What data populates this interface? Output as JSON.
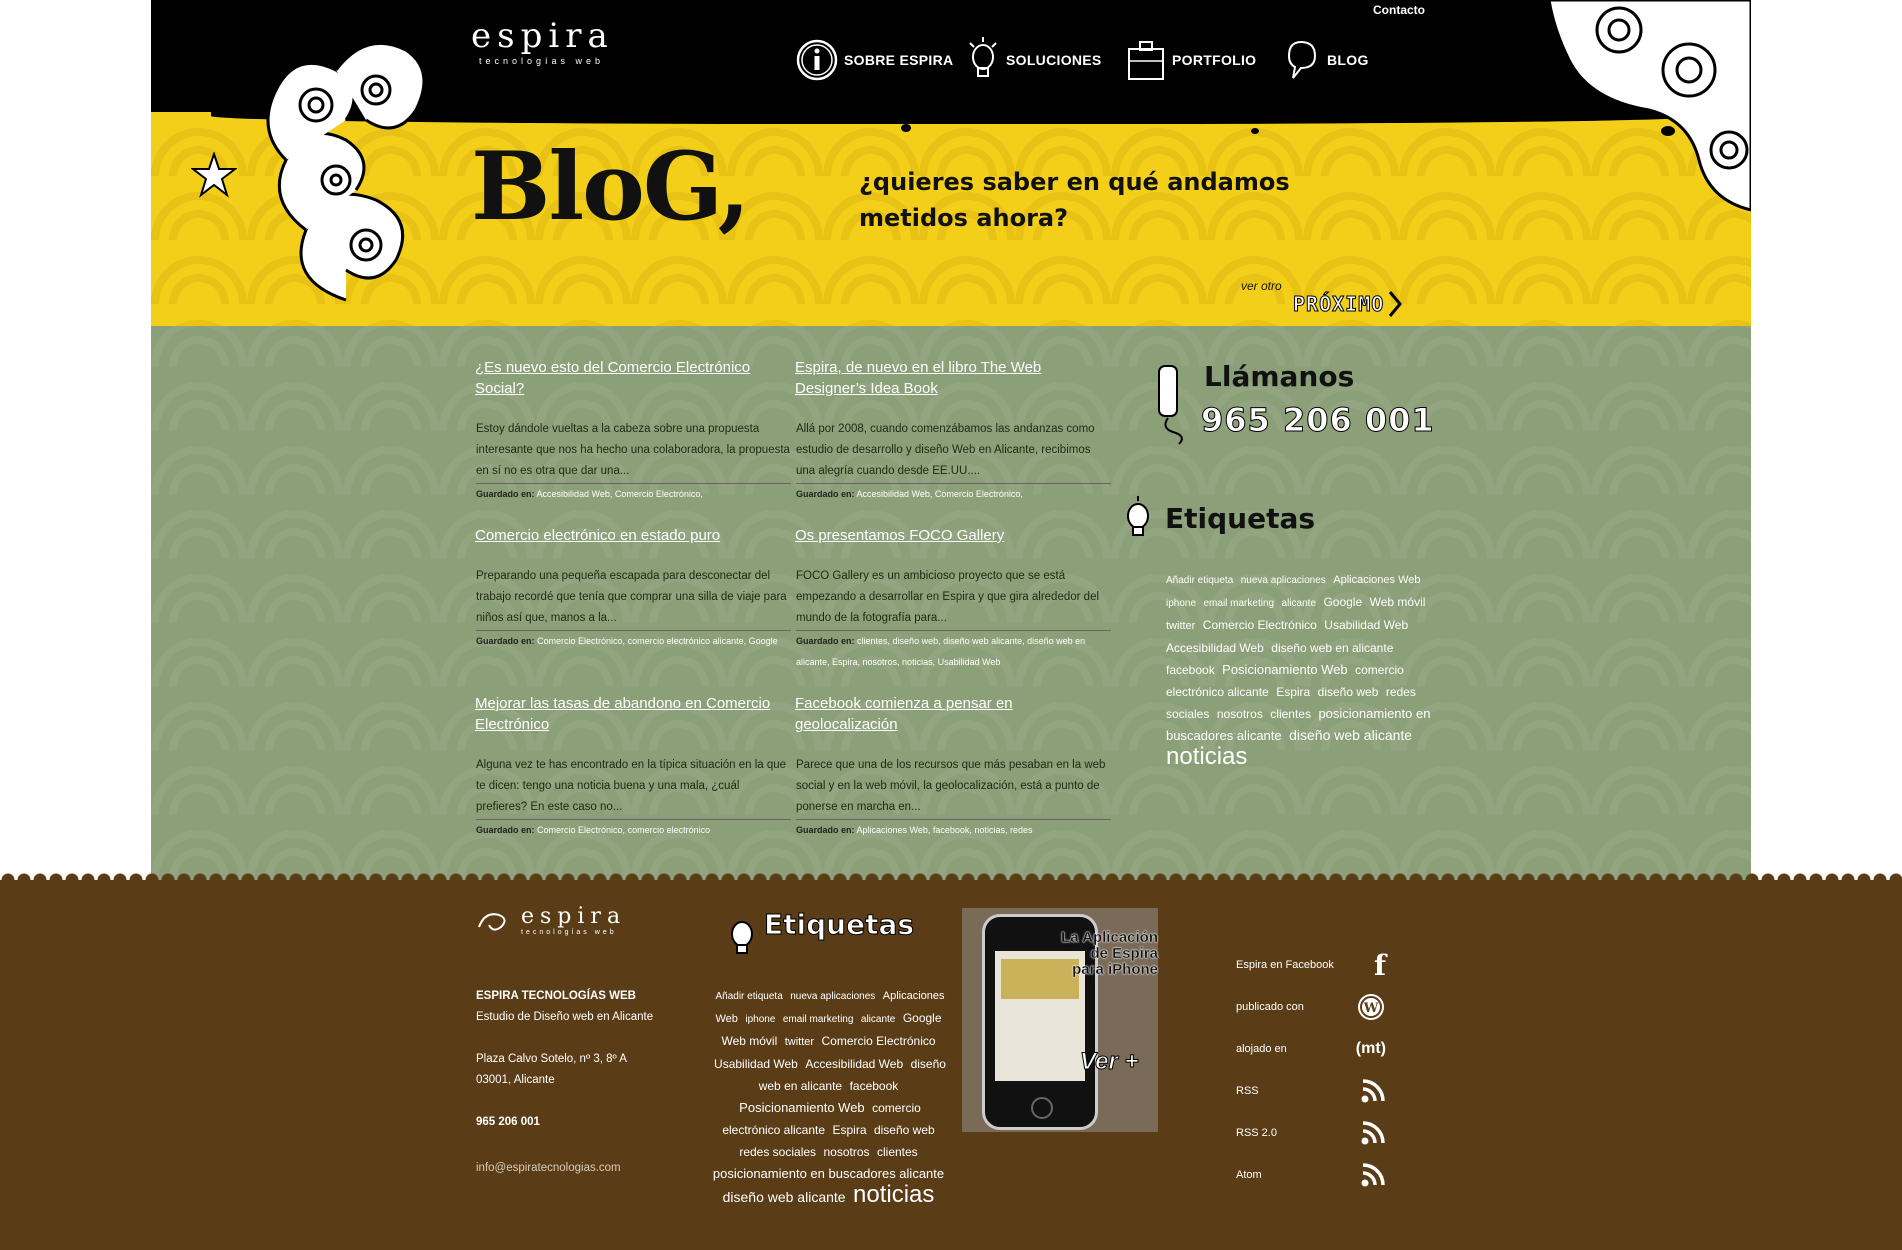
{
  "header": {
    "logo_main": "espira",
    "logo_sub": "tecnologías web",
    "contact_link": "Contacto",
    "nav": [
      {
        "label": "SOBRE ESPIRA",
        "icon": "info-icon"
      },
      {
        "label": "SOLUCIONES",
        "icon": "lightbulb-icon"
      },
      {
        "label": "PORTFOLIO",
        "icon": "briefcase-icon"
      },
      {
        "label": "BLOG",
        "icon": "speech-icon"
      }
    ]
  },
  "hero": {
    "title": "BloG,",
    "tagline_1": "¿quieres saber en qué andamos",
    "tagline_2": "metidos ahora?",
    "next_small": "ver otro",
    "next_label": "PRÓXIMO"
  },
  "posts": [
    {
      "title": "¿Es nuevo esto del Comercio Electrónico Social?",
      "excerpt": "Estoy dándole vueltas a la cabeza sobre una propuesta interesante que nos ha hecho una colaboradora, la propuesta en sí no es otra que dar una...",
      "tags_label": "Guardado en:",
      "tags": "Accesibilidad Web, Comercio Electrónico,"
    },
    {
      "title": "Espira, de nuevo en el libro The Web Designer’s Idea Book",
      "excerpt": "Allá por 2008, cuando comenzábamos las andanzas como estudio de desarrollo y diseño Web en Alicante, recibimos una alegría cuando desde EE.UU....",
      "tags_label": "Guardado en:",
      "tags": "Accesibilidad Web, Comercio Electrónico,"
    },
    {
      "title": "Comercio electrónico en estado puro",
      "excerpt": "Preparando una pequeña escapada para desconectar del trabajo recordé que tenía que comprar una silla de viaje para niños así que, manos a la...",
      "tags_label": "Guardado en:",
      "tags": "Comercio Electrónico, comercio electrónico alicante, Google"
    },
    {
      "title": "Os presentamos FOCO Gallery",
      "excerpt": "FOCO Gallery es un ambicioso proyecto que se está empezando a desarrollar en Espira y que gira alrededor del mundo de la fotografía para...",
      "tags_label": "Guardado en:",
      "tags": "clientes, diseño web, diseño web alicante, diseño web en alicante, Espira, nosotros, noticias, Usabilidad Web"
    },
    {
      "title": "Mejorar las tasas de abandono en Comercio Electrónico",
      "excerpt": "Alguna vez te has encontrado en la típica situación en la que te dicen: tengo una noticia buena y una mala, ¿cuál prefieres? En este caso no...",
      "tags_label": "Guardado en:",
      "tags": "Comercio Electrónico, comercio electrónico"
    },
    {
      "title": "Facebook comienza a pensar en geolocalización",
      "excerpt": "Parece que una de los recursos que más pesaban en la web social y en la web móvil, la geolocalización, está a punto de ponerse en marcha en...",
      "tags_label": "Guardado en:",
      "tags": "Aplicaciones Web, facebook, noticias, redes"
    }
  ],
  "sidebar": {
    "call_title": "Llámanos",
    "call_number": "965 206 001",
    "tags_title": "Etiquetas",
    "cloud": [
      {
        "t": "Añadir etiqueta",
        "s": 10
      },
      {
        "t": "nueva aplicaciones",
        "s": 10
      },
      {
        "t": "Aplicaciones Web",
        "s": 11
      },
      {
        "t": "iphone",
        "s": 10
      },
      {
        "t": "email marketing",
        "s": 10
      },
      {
        "t": "alicante",
        "s": 10
      },
      {
        "t": "Google",
        "s": 12
      },
      {
        "t": "Web móvil",
        "s": 12
      },
      {
        "t": "twitter",
        "s": 11
      },
      {
        "t": "Comercio Electrónico",
        "s": 12
      },
      {
        "t": "Usabilidad Web",
        "s": 12
      },
      {
        "t": "Accesibilidad Web",
        "s": 12
      },
      {
        "t": "diseño web en alicante",
        "s": 12
      },
      {
        "t": "facebook",
        "s": 12
      },
      {
        "t": "Posicionamiento Web",
        "s": 13
      },
      {
        "t": "comercio electrónico alicante",
        "s": 12
      },
      {
        "t": "Espira",
        "s": 12
      },
      {
        "t": "diseño web",
        "s": 12
      },
      {
        "t": "redes sociales",
        "s": 12
      },
      {
        "t": "nosotros",
        "s": 12
      },
      {
        "t": "clientes",
        "s": 12
      },
      {
        "t": "posicionamiento en buscadores alicante",
        "s": 13
      },
      {
        "t": "diseño web alicante",
        "s": 14
      },
      {
        "t": "noticias",
        "s": 24
      }
    ]
  },
  "footer": {
    "logo_main": "espira",
    "logo_sub": "tecnologías web",
    "company": "ESPIRA TECNOLOGÍAS WEB",
    "tagline": "Estudio de Diseño web en Alicante",
    "address_1": "Plaza Calvo Sotelo, nº 3, 8º A",
    "address_2": "03001, Alicante",
    "phone": "965 206 001",
    "email": "info@espiratecnologias.com",
    "tags_title": "Etiquetas",
    "app_line1": "La Aplicación",
    "app_line2": "de Espira",
    "app_line3": "para iPhone",
    "app_cta": "Ver +",
    "social": [
      {
        "label": "Espira en Facebook",
        "icon": "facebook-icon"
      },
      {
        "label": "publicado con",
        "icon": "wordpress-icon"
      },
      {
        "label": "alojado en",
        "icon": "mediatemple-icon"
      },
      {
        "label": "RSS",
        "icon": "rss-icon"
      },
      {
        "label": "RSS 2.0",
        "icon": "rss-icon"
      },
      {
        "label": "Atom",
        "icon": "rss-icon"
      }
    ],
    "mt_text": "(mt)"
  },
  "colors": {
    "yellow": "#f3cf1a",
    "green": "#8b9f78",
    "brown": "#5a3d17",
    "black": "#000000"
  }
}
